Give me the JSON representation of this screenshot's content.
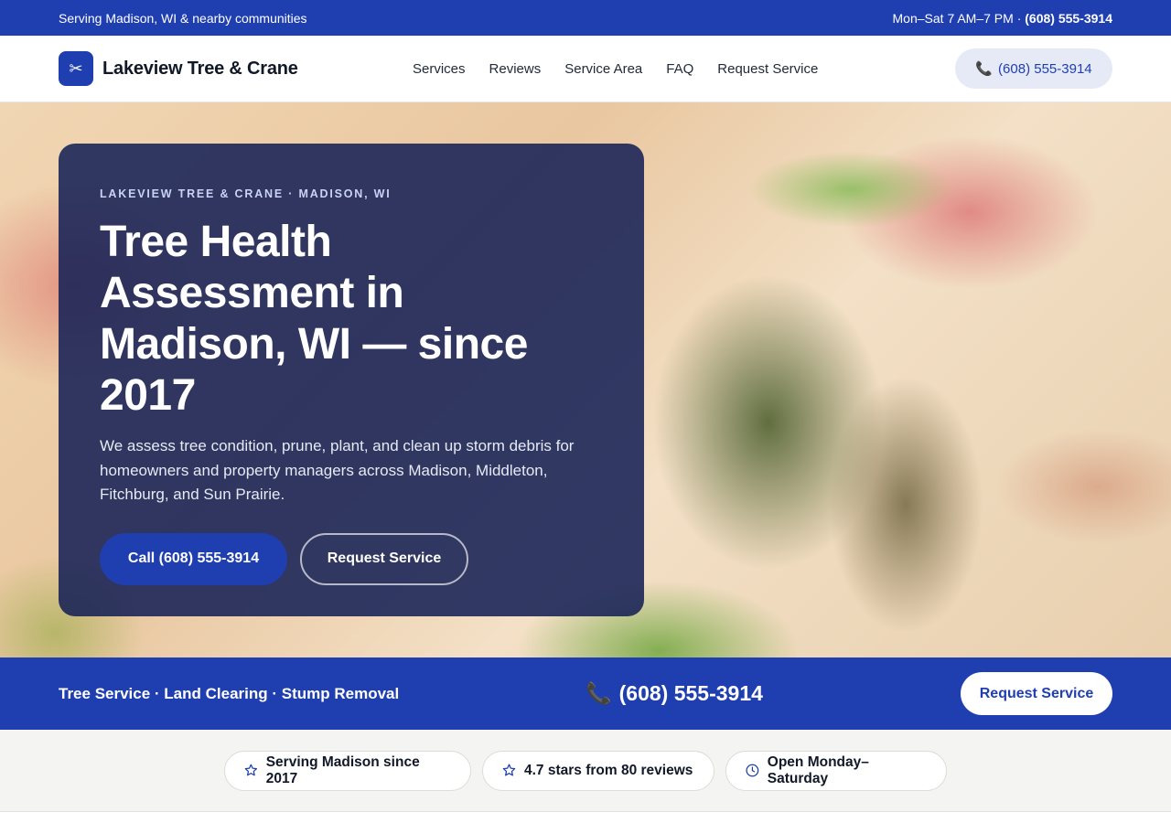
{
  "topbar": {
    "left_text": "Serving Madison, WI & nearby communities",
    "hours": "Mon–Sat 7 AM–7 PM ·",
    "phone": "(608) 555-3914"
  },
  "header": {
    "logo_icon": "scissors-icon",
    "brand": "Lakeview Tree & Crane",
    "nav": [
      "Services",
      "Reviews",
      "Service Area",
      "FAQ",
      "Request Service"
    ],
    "call_button": "(608) 555-3914"
  },
  "hero": {
    "eyebrow": "LAKEVIEW TREE & CRANE · MADISON, WI",
    "title": "Tree Health Assessment in Madison, WI — since 2017",
    "subtitle": "We assess tree condition, prune, plant, and clean up storm debris for homeowners and property managers across Madison, Middleton, Fitchburg, and Sun Prairie.",
    "primary_button": "Call (608) 555-3914",
    "secondary_button": "Request Service"
  },
  "strip": {
    "services": "Tree Service · Land Clearing · Stump Removal",
    "phone": "(608) 555-3914",
    "button": "Request Service"
  },
  "badges": [
    {
      "icon": "star-icon",
      "label": "Serving Madison since 2017"
    },
    {
      "icon": "star-icon",
      "label": "4.7 stars from 80 reviews"
    },
    {
      "icon": "clock-icon",
      "label": "Open Monday–Saturday"
    }
  ],
  "colors": {
    "brand_blue": "#1f3fb0",
    "hero_card": "#162155",
    "light_bg": "#f4f4f3"
  }
}
